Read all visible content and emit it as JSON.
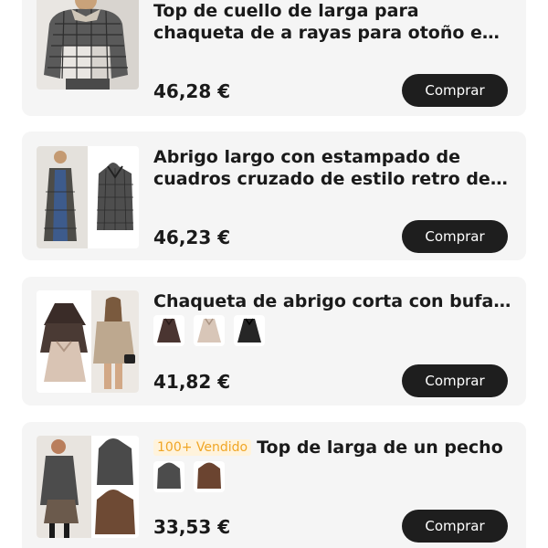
{
  "products": [
    {
      "title": "Top de cuello de larga para chaqueta de a rayas para otoño e invierno",
      "price": "46,28 €",
      "buy_label": "Comprar",
      "image": "plaid-jacket-photo"
    },
    {
      "title": "Abrigo largo con estampado de cuadros cruzado de estilo retro de otoño",
      "price": "46,23 €",
      "buy_label": "Comprar",
      "image": "long-plaid-coat-photo"
    },
    {
      "title": "Chaqueta de abrigo corta con bufanda",
      "price": "41,82 €",
      "buy_label": "Comprar",
      "image": "short-cape-coat-photo",
      "variants": [
        "brown",
        "beige",
        "black"
      ]
    },
    {
      "badge": "100+ Vendido",
      "title": "Top de larga de un pecho",
      "price": "33,53 €",
      "buy_label": "Comprar",
      "image": "hooded-coat-photo",
      "variants": [
        "grey",
        "brown"
      ]
    }
  ],
  "colors": {
    "card_bg": "#f5f5f5",
    "button_bg": "#1e1e1e",
    "badge_text": "#f0a626",
    "badge_bg": "#fff3dc"
  }
}
